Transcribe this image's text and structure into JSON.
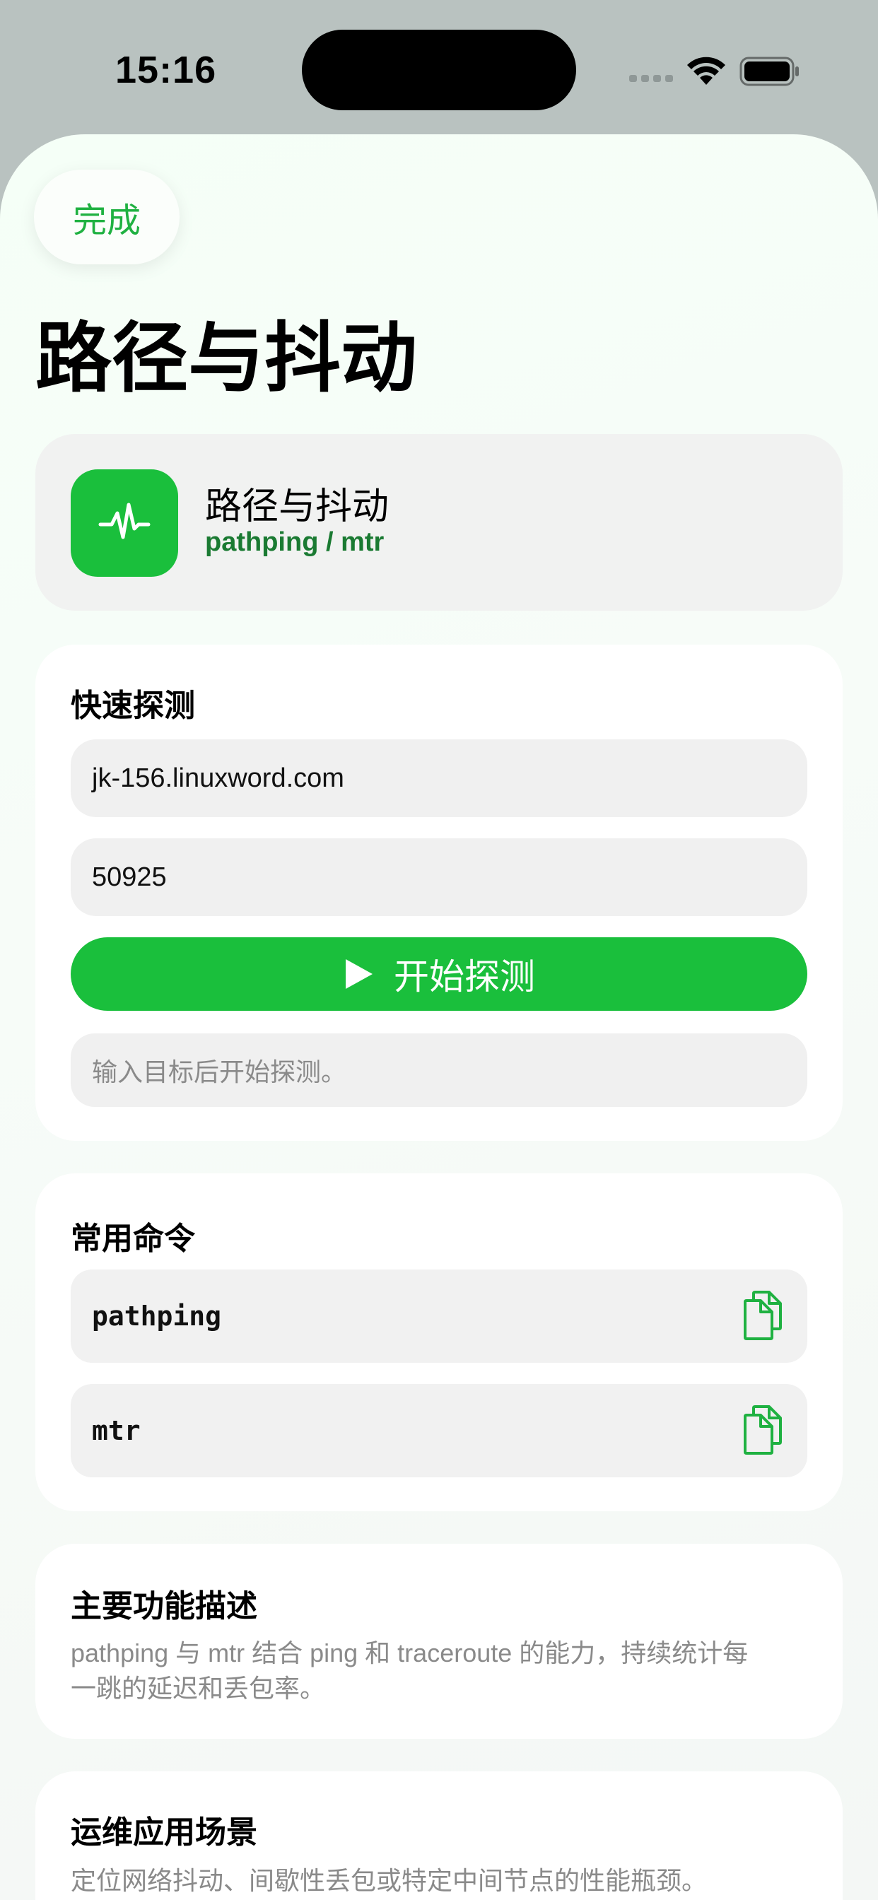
{
  "status_bar": {
    "time": "15:16"
  },
  "nav": {
    "done_label": "完成"
  },
  "page": {
    "title": "路径与抖动"
  },
  "header": {
    "icon": "waveform-pulse-icon",
    "title": "路径与抖动",
    "subtitle": "pathping / mtr",
    "accent_color": "#1abf3c"
  },
  "quick_probe": {
    "title": "快速探测",
    "host_value": "jk-156.linuxword.com",
    "port_value": "50925",
    "start_label": "开始探测",
    "hint": "输入目标后开始探测。"
  },
  "commands": {
    "title": "常用命令",
    "items": [
      {
        "name": "pathping",
        "icon": "copy-icon"
      },
      {
        "name": "mtr",
        "icon": "copy-icon"
      }
    ]
  },
  "description": {
    "title": "主要功能描述",
    "line1": "pathping 与 mtr 结合 ping 和 traceroute 的能力，持续统计每",
    "line2": "一跳的延迟和丢包率。"
  },
  "scenarios": {
    "title": "运维应用场景",
    "text": "定位网络抖动、间歇性丢包或特定中间节点的性能瓶颈。"
  }
}
